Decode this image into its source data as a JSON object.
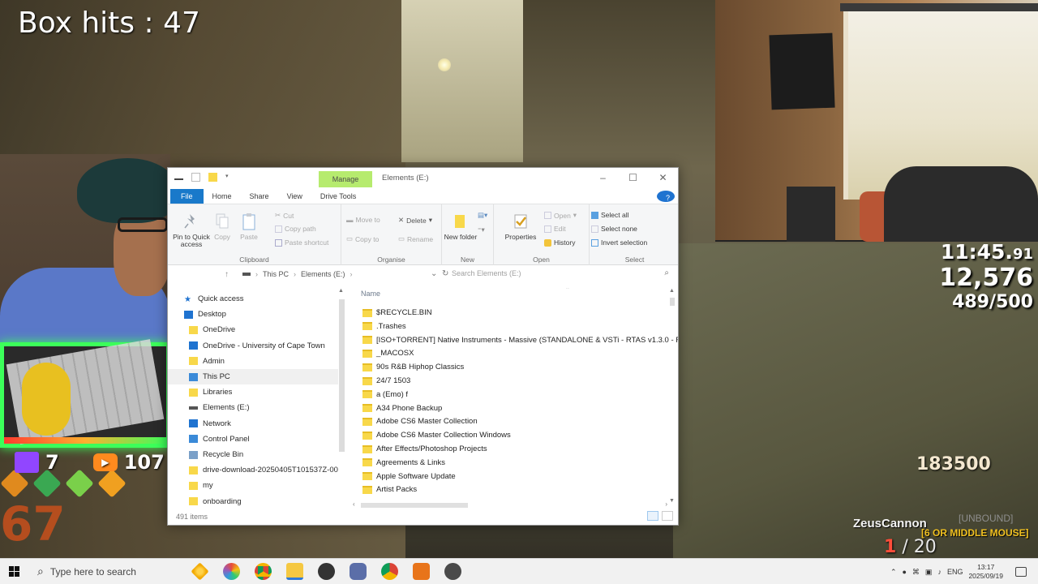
{
  "overlay": {
    "box_hits": "Box hits : 47",
    "timer_main": "11:45.",
    "timer_fraction": "91",
    "score_total": "12,576",
    "progress": "489/500",
    "points": "183500",
    "player_name": "ZeusCannon",
    "unbound_label": "[UNBOUND]",
    "bind_hint": "[6 OR MIDDLE MOUSE]",
    "ammo_current": "1",
    "ammo_total": "/ 20",
    "twitch_count": "7",
    "youtube_count": "107",
    "big_number": "67"
  },
  "window": {
    "manage_tab": "Manage",
    "title": "Elements (E:)",
    "tabs": [
      "File",
      "Home",
      "Share",
      "View",
      "Drive Tools"
    ],
    "help_label": "?",
    "ribbon": {
      "clipboard": {
        "label": "Clipboard",
        "pin": "Pin to Quick access",
        "copy": "Copy",
        "paste": "Paste",
        "cut": "Cut",
        "copy_path": "Copy path",
        "paste_shortcut": "Paste shortcut"
      },
      "organise": {
        "label": "Organise",
        "move_to": "Move to",
        "copy_to": "Copy to",
        "delete": "Delete",
        "rename": "Rename"
      },
      "new": {
        "label": "New",
        "new_folder": "New folder"
      },
      "open": {
        "label": "Open",
        "properties": "Properties",
        "open": "Open",
        "edit": "Edit",
        "history": "History"
      },
      "select": {
        "label": "Select",
        "select_all": "Select all",
        "select_none": "Select none",
        "invert": "Invert selection"
      }
    },
    "address": {
      "crumbs": [
        "This PC",
        "Elements (E:)"
      ],
      "search_placeholder": "Search Elements (E:)"
    },
    "nav": [
      {
        "label": "Quick access",
        "icon": "star-icon",
        "indent": 0
      },
      {
        "label": "Desktop",
        "icon": "desktop-icon",
        "indent": 0
      },
      {
        "label": "OneDrive",
        "icon": "folder-icon",
        "indent": 1
      },
      {
        "label": "OneDrive - University of Cape Town",
        "icon": "cloud-icon",
        "indent": 1
      },
      {
        "label": "Admin",
        "icon": "user-icon",
        "indent": 1
      },
      {
        "label": "This PC",
        "icon": "pc-icon",
        "indent": 1
      },
      {
        "label": "Libraries",
        "icon": "library-icon",
        "indent": 1
      },
      {
        "label": "Elements (E:)",
        "icon": "drive-icon",
        "indent": 1
      },
      {
        "label": "Network",
        "icon": "network-icon",
        "indent": 1
      },
      {
        "label": "Control Panel",
        "icon": "control-panel-icon",
        "indent": 1
      },
      {
        "label": "Recycle Bin",
        "icon": "recycle-bin-icon",
        "indent": 1
      },
      {
        "label": "drive-download-20250405T101537Z-00",
        "icon": "folder-icon",
        "indent": 1
      },
      {
        "label": "my",
        "icon": "folder-icon",
        "indent": 1
      },
      {
        "label": "onboarding",
        "icon": "folder-icon",
        "indent": 1
      }
    ],
    "column_name": "Name",
    "files": [
      "$RECYCLE.BIN",
      ".Trashes",
      "[ISO+TORRENT] Native Instruments - Massive (STANDALONE & VSTi - RTAS v1.3.0 - For",
      "_MACOSX",
      "90s R&B Hiphop Classics",
      "24/7 1503",
      "a (Emo) f",
      "A34 Phone Backup",
      "Adobe CS6 Master Collection",
      "Adobe CS6 Master Collection Windows",
      "After Effects/Photoshop Projects",
      "Agreements & Links",
      "Apple Software Update",
      "Artist Packs"
    ],
    "status": "491 items"
  },
  "taskbar": {
    "search_placeholder": "Type here to search",
    "language": "ENG",
    "time": "13:17",
    "date": "2025/09/19"
  },
  "colors": {
    "file_tab": "#1979ca",
    "manage_tab": "#b6eb6e",
    "folder": "#f8d84a",
    "keyboard_border": "#3cff5a"
  }
}
